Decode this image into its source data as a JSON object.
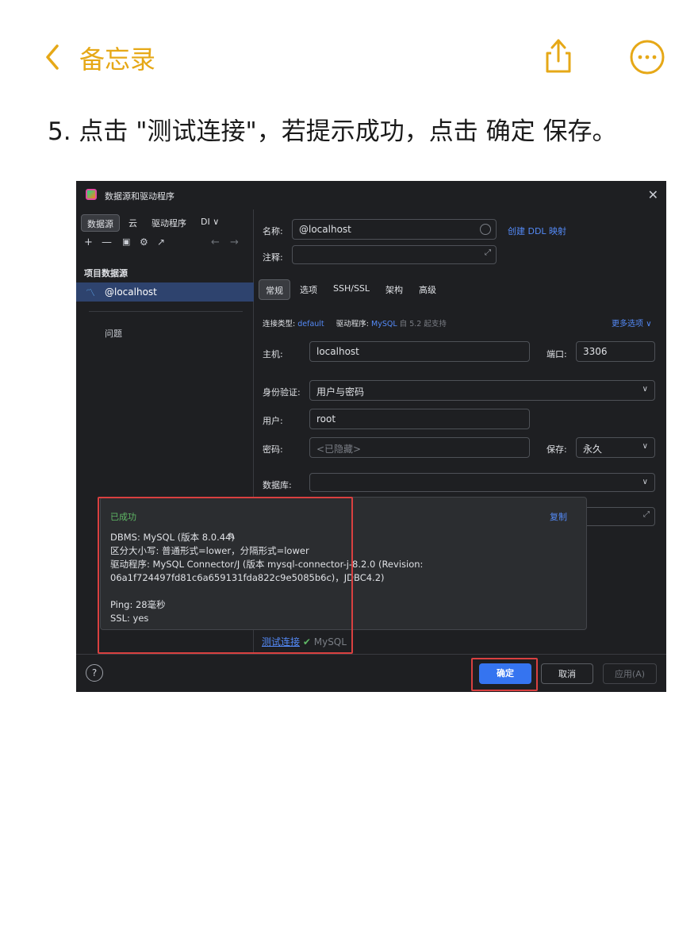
{
  "nav": {
    "title": "备忘录"
  },
  "instruction": "5. 点击 \"测试连接\"，若提示成功，点击 确定 保存。",
  "ide": {
    "window_title": "数据源和驱动程序",
    "left_tabs": [
      "数据源",
      "云",
      "驱动程序",
      "DI"
    ],
    "toolbar_icons": [
      "add-icon",
      "remove-icon",
      "duplicate-icon",
      "settings-icon",
      "export-icon",
      "back-icon",
      "forward-icon"
    ],
    "section_title": "项目数据源",
    "selected_source": "@localhost",
    "problems_label": "问题",
    "name_label": "名称:",
    "name_value": "@localhost",
    "create_ddl_link": "创建 DDL 映射",
    "comment_label": "注释:",
    "tabs": [
      "常规",
      "选项",
      "SSH/SSL",
      "架构",
      "高级"
    ],
    "conn_type_label": "连接类型:",
    "conn_type_value": "default",
    "driver_label": "驱动程序:",
    "driver_value": "MySQL",
    "driver_note": "自 5.2 起支持",
    "more_options": "更多选项",
    "host_label": "主机:",
    "host_value": "localhost",
    "port_label": "端口:",
    "port_value": "3306",
    "auth_label": "身份验证:",
    "auth_value": "用户与密码",
    "user_label": "用户:",
    "user_value": "root",
    "password_label": "密码:",
    "password_placeholder": "<已隐藏>",
    "save_label": "保存:",
    "save_value": "永久",
    "database_label": "数据库:",
    "popup": {
      "status": "已成功",
      "copy": "复制",
      "body": "DBMS: MySQL (版本 8.0.44)\n区分大小写: 普通形式=lower，分隔形式=lower\n驱动程序: MySQL Connector/J (版本 mysql-connector-j-8.2.0 (Revision:\n06a1f724497fd81c6a659131fda822c9e5085b6c)，JDBC4.2)\n\nPing: 28毫秒\nSSL: yes"
    },
    "test_link": "测试连接",
    "test_result": "MySQL",
    "ok_button": "确定",
    "cancel_button": "取消",
    "apply_button": "应用(A)",
    "help_label": "?"
  },
  "colors": {
    "accent_yellow": "#e6a817",
    "highlight_red": "#d94040",
    "primary_blue": "#3574f0",
    "success_green": "#5fb865"
  }
}
